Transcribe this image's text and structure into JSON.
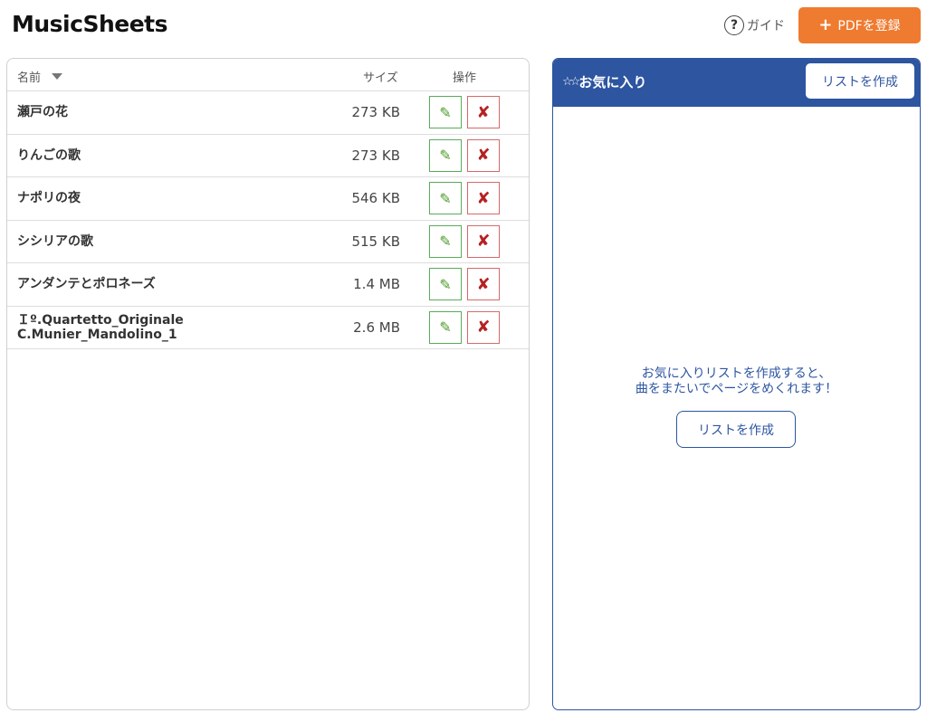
{
  "header": {
    "app_title": "MusicSheets",
    "guide_label": "ガイド",
    "guide_icon": "question-circle-icon",
    "register_label": "PDFを登録",
    "register_icon": "+",
    "register_color": "#ee7b30"
  },
  "file_table": {
    "columns": {
      "name": "名前",
      "size": "サイズ",
      "actions": "操作"
    },
    "sort_icon": "caret-down-icon",
    "rows": [
      {
        "name": "瀬戸の花",
        "size": "273 KB"
      },
      {
        "name": "りんごの歌",
        "size": "273 KB"
      },
      {
        "name": "ナポリの夜",
        "size": "546 KB"
      },
      {
        "name": "シシリアの歌",
        "size": "515 KB"
      },
      {
        "name": "アンダンテとポロネーズ",
        "size": "1.4 MB"
      },
      {
        "name": "Ｉº.Quartetto_Originale\nC.Munier_Mandolino_1",
        "size": "2.6 MB"
      }
    ],
    "edit_icon": "✎",
    "delete_icon": "✘"
  },
  "favorites": {
    "title": "お気に入り",
    "title_icon": "☆☆",
    "header_button": "リストを作成",
    "empty_line1": "お気に入りリストを作成すると、",
    "empty_line2": "曲をまたいでページをめくれます！",
    "empty_button": "リストを作成",
    "accent_color": "#2d55a0"
  }
}
